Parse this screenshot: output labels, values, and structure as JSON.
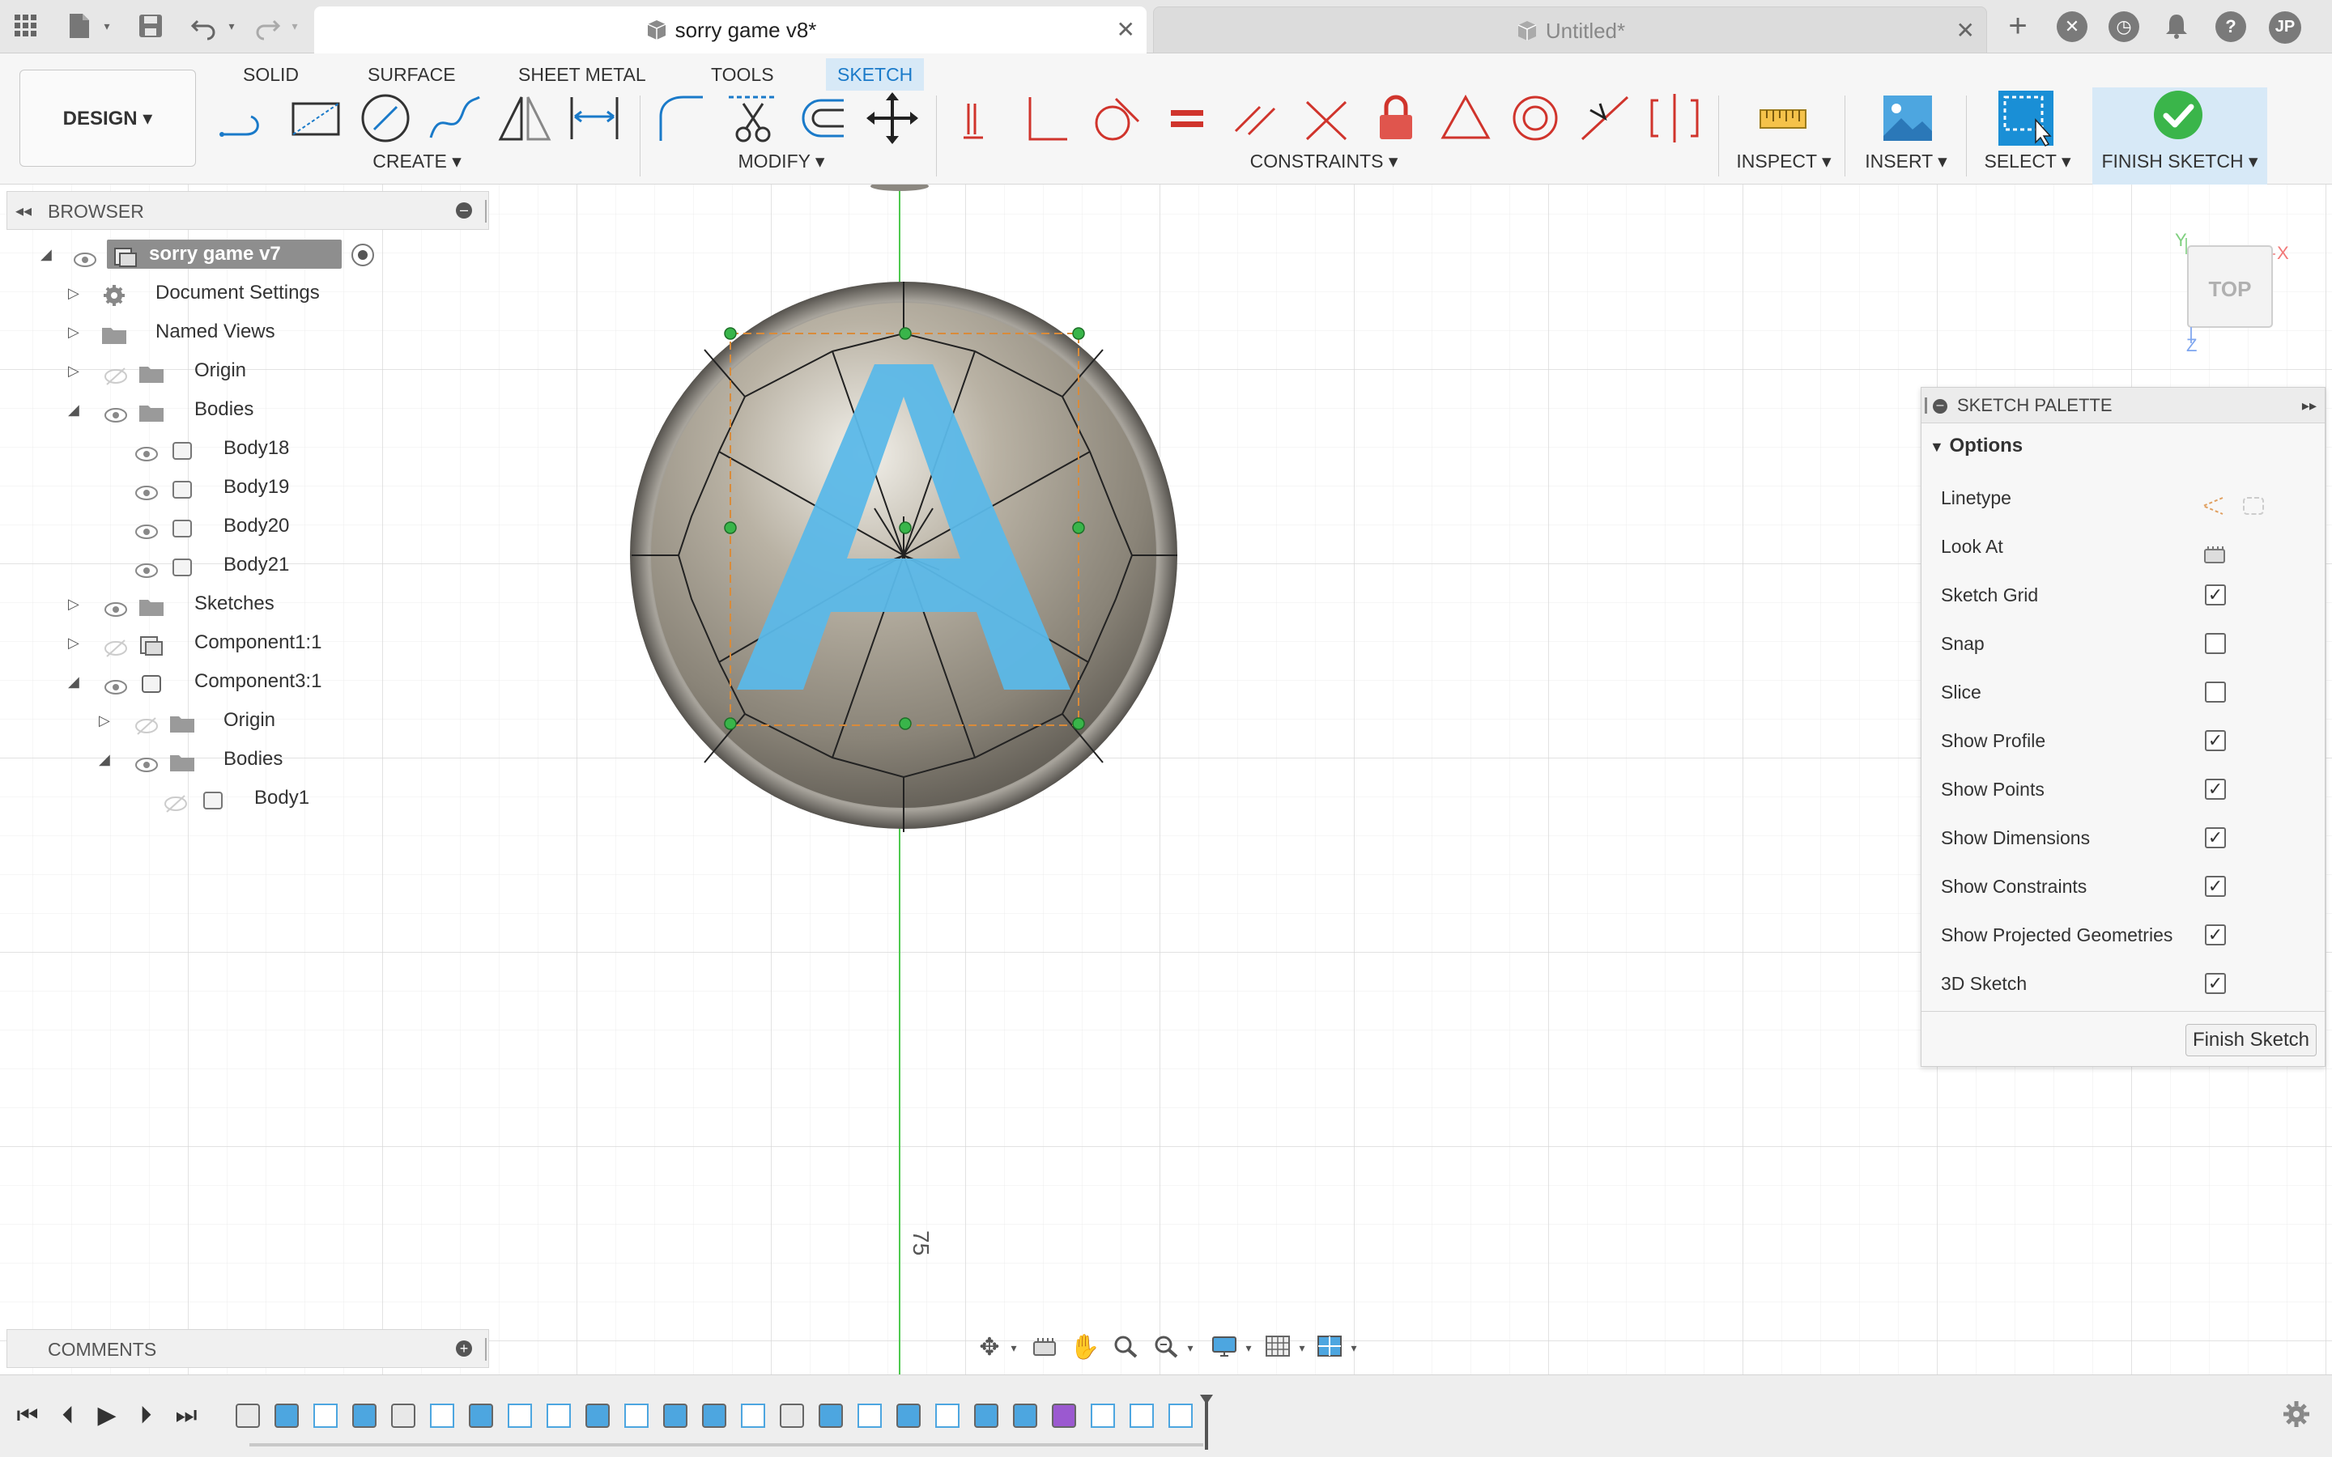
{
  "titlebar": {
    "active_tab": "sorry game v8*",
    "inactive_tab": "Untitled*",
    "user_initials": "JP"
  },
  "ribbon": {
    "tabs": [
      "SOLID",
      "SURFACE",
      "SHEET METAL",
      "TOOLS",
      "SKETCH"
    ],
    "active_tab": "SKETCH",
    "workspace": "DESIGN",
    "groups": {
      "create": "CREATE",
      "modify": "MODIFY",
      "constraints": "CONSTRAINTS",
      "inspect": "INSPECT",
      "insert": "INSERT",
      "select": "SELECT",
      "finish": "FINISH SKETCH"
    }
  },
  "browser": {
    "title": "BROWSER",
    "root": "sorry game v7",
    "items": [
      {
        "label": "Document Settings"
      },
      {
        "label": "Named Views"
      },
      {
        "label": "Origin"
      },
      {
        "label": "Bodies"
      },
      {
        "label": "Body18"
      },
      {
        "label": "Body19"
      },
      {
        "label": "Body20"
      },
      {
        "label": "Body21"
      },
      {
        "label": "Sketches"
      },
      {
        "label": "Component1:1"
      },
      {
        "label": "Component3:1"
      },
      {
        "label": "Origin"
      },
      {
        "label": "Bodies"
      },
      {
        "label": "Body1"
      }
    ]
  },
  "comments": {
    "title": "COMMENTS"
  },
  "canvas": {
    "dimension_label": "75",
    "letter": "A",
    "viewcube_face": "TOP",
    "axis_x": "X",
    "axis_y": "Y",
    "axis_z": "Z"
  },
  "palette": {
    "title": "SKETCH PALETTE",
    "section": "Options",
    "options": [
      {
        "label": "Linetype",
        "kind": "icons"
      },
      {
        "label": "Look At",
        "kind": "icon"
      },
      {
        "label": "Sketch Grid",
        "checked": true
      },
      {
        "label": "Snap",
        "checked": false
      },
      {
        "label": "Slice",
        "checked": false
      },
      {
        "label": "Show Profile",
        "checked": true
      },
      {
        "label": "Show Points",
        "checked": true
      },
      {
        "label": "Show Dimensions",
        "checked": true
      },
      {
        "label": "Show Constraints",
        "checked": true
      },
      {
        "label": "Show Projected Geometries",
        "checked": true
      },
      {
        "label": "3D Sketch",
        "checked": true
      }
    ],
    "finish_button": "Finish Sketch"
  },
  "colors": {
    "accent": "#1a7ac9",
    "constraint_red": "#d0342c",
    "sketch_blue": "#5bb8e8",
    "finish_green": "#3ab54a",
    "point_green": "#39b54a"
  }
}
